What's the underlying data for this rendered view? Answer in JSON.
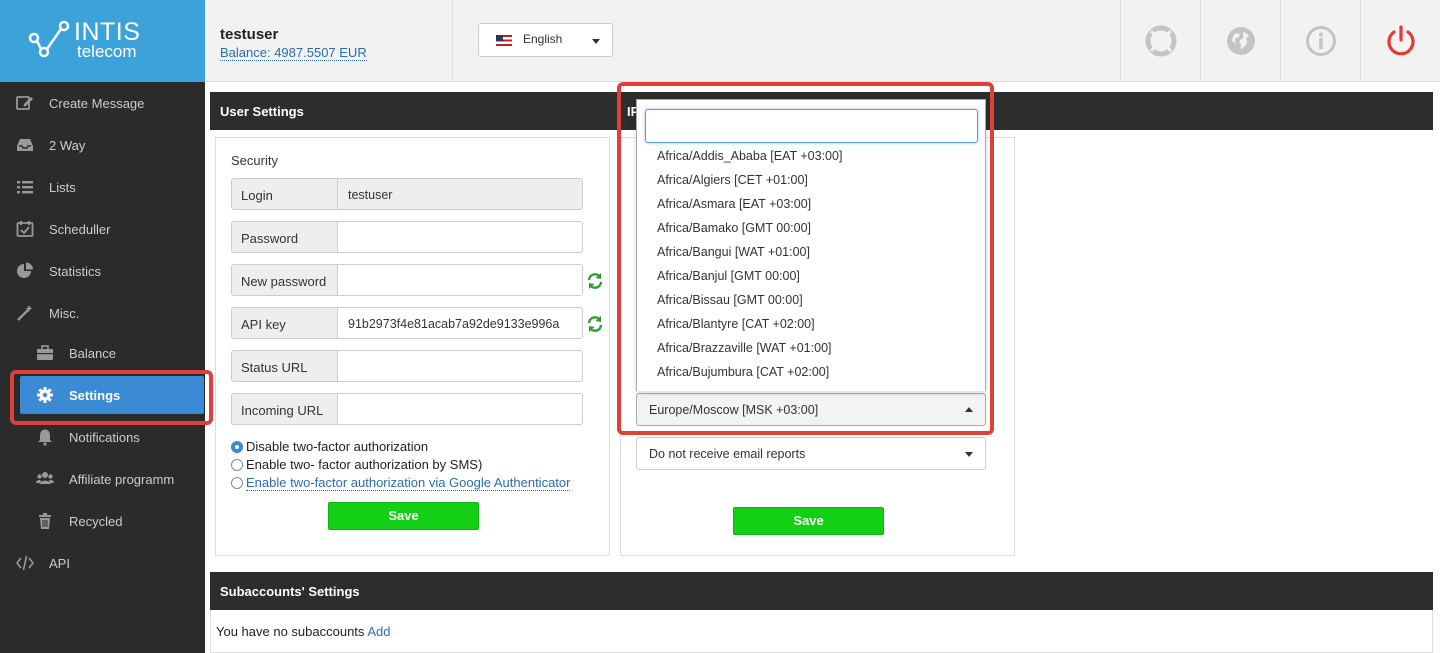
{
  "logo": {
    "line1": "INTIS",
    "line2": "telecom"
  },
  "header": {
    "username": "testuser",
    "balance": "Balance: 4987.5507 EUR",
    "language": "English",
    "icons": [
      "lifebuoy-icon",
      "globe-icon",
      "info-icon",
      "power-icon"
    ]
  },
  "sidebar": {
    "items": [
      {
        "label": "Create Message",
        "icon": "edit-icon"
      },
      {
        "label": "2 Way",
        "icon": "inbox-icon"
      },
      {
        "label": "Lists",
        "icon": "list-icon"
      },
      {
        "label": "Scheduller",
        "icon": "calendar-icon"
      },
      {
        "label": "Statistics",
        "icon": "pie-chart-icon"
      },
      {
        "label": "Misc.",
        "icon": "magic-wand-icon"
      },
      {
        "label": "Balance",
        "icon": "briefcase-icon"
      },
      {
        "label": "Settings",
        "icon": "gear-icon"
      },
      {
        "label": "Notifications",
        "icon": "bell-icon"
      },
      {
        "label": "Affiliate programm",
        "icon": "users-icon"
      },
      {
        "label": "Recycled",
        "icon": "trash-icon"
      },
      {
        "label": "API",
        "icon": "code-icon"
      }
    ]
  },
  "user_settings": {
    "title": "User Settings",
    "security_title": "Security",
    "fields": [
      {
        "label": "Login",
        "value": "testuser"
      },
      {
        "label": "Password",
        "value": ""
      },
      {
        "label": "New password",
        "value": ""
      },
      {
        "label": "API key",
        "value": "91b2973f4e81acab7a92de9133e996a"
      },
      {
        "label": "Status URL",
        "value": ""
      },
      {
        "label": "Incoming URL",
        "value": ""
      }
    ],
    "radios": [
      "Disable two-factor authorization",
      "Enable two- factor authorization by SMS)",
      "Enable two-factor authorization via Google Authenticator"
    ],
    "save": "Save"
  },
  "ip_panel": {
    "title_fragment": "IP",
    "timezone_selected": "Europe/Moscow [MSK +03:00]",
    "email_reports": "Do not receive email reports",
    "save": "Save"
  },
  "timezone_dropdown": {
    "search_value": "",
    "options": [
      "Africa/Addis_Ababa [EAT +03:00]",
      "Africa/Algiers [CET +01:00]",
      "Africa/Asmara [EAT +03:00]",
      "Africa/Bamako [GMT 00:00]",
      "Africa/Bangui [WAT +01:00]",
      "Africa/Banjul [GMT 00:00]",
      "Africa/Bissau [GMT 00:00]",
      "Africa/Blantyre [CAT +02:00]",
      "Africa/Brazzaville [WAT +01:00]",
      "Africa/Bujumbura [CAT +02:00]"
    ]
  },
  "subaccounts": {
    "title": "Subaccounts' Settings",
    "text": "You have no subaccounts",
    "add": "Add"
  },
  "colors": {
    "brand": "#3ba3d9",
    "active_nav": "#3a8ad4",
    "save_green": "#14d014",
    "highlight": "#e0403a",
    "power": "#e53935"
  }
}
